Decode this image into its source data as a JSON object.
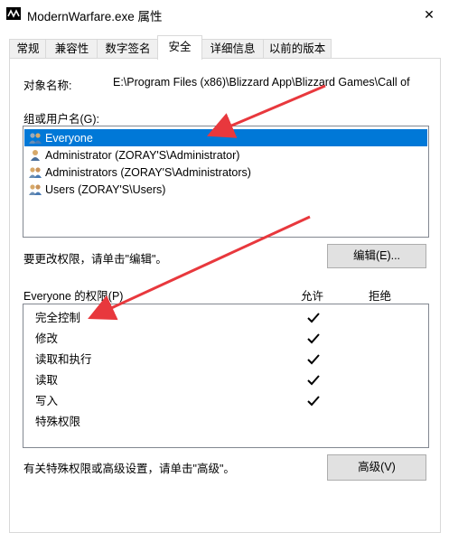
{
  "window": {
    "title": "ModernWarfare.exe 属性",
    "close_glyph": "✕"
  },
  "tabs": [
    "常规",
    "兼容性",
    "数字签名",
    "安全",
    "详细信息",
    "以前的版本"
  ],
  "active_tab": "安全",
  "object": {
    "label": "对象名称:",
    "value": "E:\\Program Files (x86)\\Blizzard App\\Blizzard Games\\Call of"
  },
  "groups": {
    "label": "组或用户名(G):",
    "items": [
      {
        "name": "Everyone",
        "icon": "group-icon",
        "selected": true
      },
      {
        "name": "Administrator (ZORAY'S\\Administrator)",
        "icon": "user-icon",
        "selected": false
      },
      {
        "name": "Administrators (ZORAY'S\\Administrators)",
        "icon": "group-icon",
        "selected": false
      },
      {
        "name": "Users (ZORAY'S\\Users)",
        "icon": "group-icon",
        "selected": false
      }
    ]
  },
  "edit": {
    "hint": "要更改权限，请单击\"编辑\"。",
    "button": "编辑(E)..."
  },
  "permissions": {
    "label": "Everyone 的权限(P)",
    "allow_header": "允许",
    "deny_header": "拒绝",
    "items": [
      {
        "name": "完全控制",
        "allow": true,
        "deny": false
      },
      {
        "name": "修改",
        "allow": true,
        "deny": false
      },
      {
        "name": "读取和执行",
        "allow": true,
        "deny": false
      },
      {
        "name": "读取",
        "allow": true,
        "deny": false
      },
      {
        "name": "写入",
        "allow": true,
        "deny": false
      },
      {
        "name": "特殊权限",
        "allow": false,
        "deny": false
      }
    ]
  },
  "advanced": {
    "hint": "有关特殊权限或高级设置，请单击\"高级\"。",
    "button": "高级(V)"
  },
  "colors": {
    "selection": "#0078d7",
    "annotation_arrow": "#e8383d"
  }
}
